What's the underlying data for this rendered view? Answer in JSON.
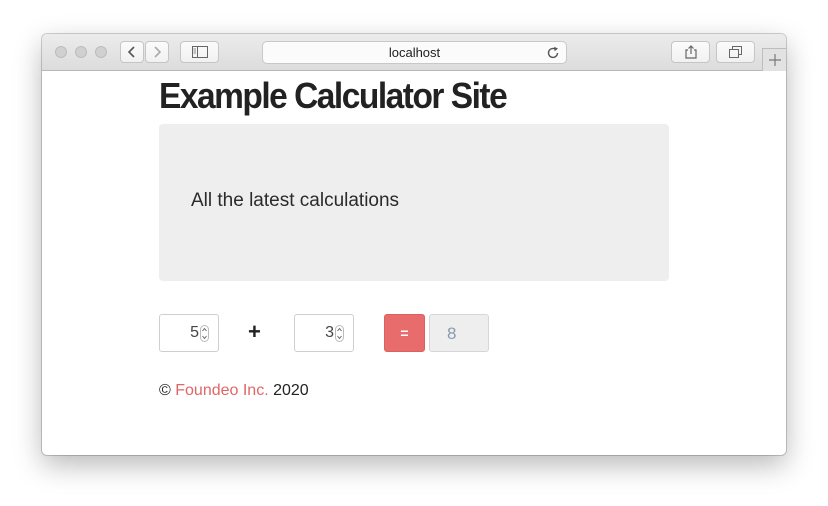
{
  "browser": {
    "address": "localhost",
    "icons": {
      "back": "chevron-left-icon",
      "forward": "chevron-right-icon",
      "sidebar": "sidebar-icon",
      "reload": "reload-icon",
      "share": "share-icon",
      "tabs": "tabs-icon",
      "new_tab": "plus-icon"
    }
  },
  "page": {
    "title": "Example Calculator Site",
    "jumbotron_text": "All the latest calculations"
  },
  "calculator": {
    "operand_a": "5",
    "operator": "+",
    "operand_b": "3",
    "equals_label": "=",
    "result": "8"
  },
  "footer": {
    "copyright_symbol": "©",
    "company": "Foundeo Inc.",
    "year": "2020"
  },
  "colors": {
    "accent": "#e86c6c",
    "link": "#e06666",
    "jumbotron_bg": "#eeeeee",
    "result_text": "#8a9bae"
  }
}
